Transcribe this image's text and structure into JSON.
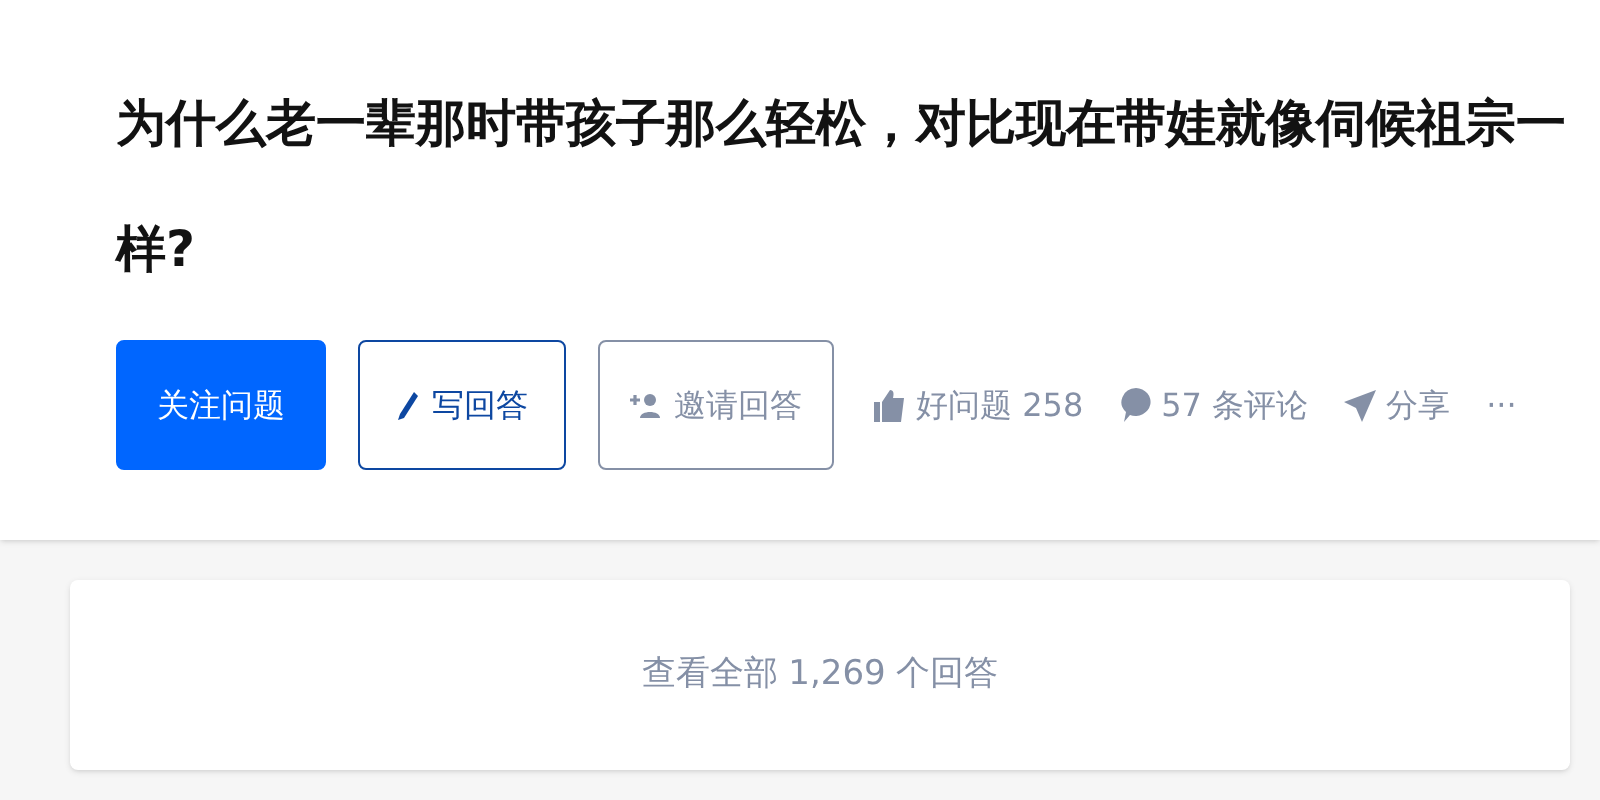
{
  "question": {
    "title": "为什么老一辈那时带孩子那么轻松，对比现在带娃就像伺候祖宗一样?"
  },
  "buttons": [
    {
      "kind": "primary",
      "label": "关注问题"
    },
    {
      "kind": "outline",
      "label": "写回答"
    },
    {
      "kind": "invite",
      "label": "邀请回答"
    }
  ],
  "actions": [
    {
      "kind": "like",
      "label": "好问题 258"
    },
    {
      "kind": "comment",
      "label": "57 条评论"
    },
    {
      "kind": "share",
      "label": "分享"
    },
    {
      "kind": "more",
      "label": "···"
    }
  ],
  "answers_link": {
    "label": "查看全部 1,269 个回答"
  }
}
